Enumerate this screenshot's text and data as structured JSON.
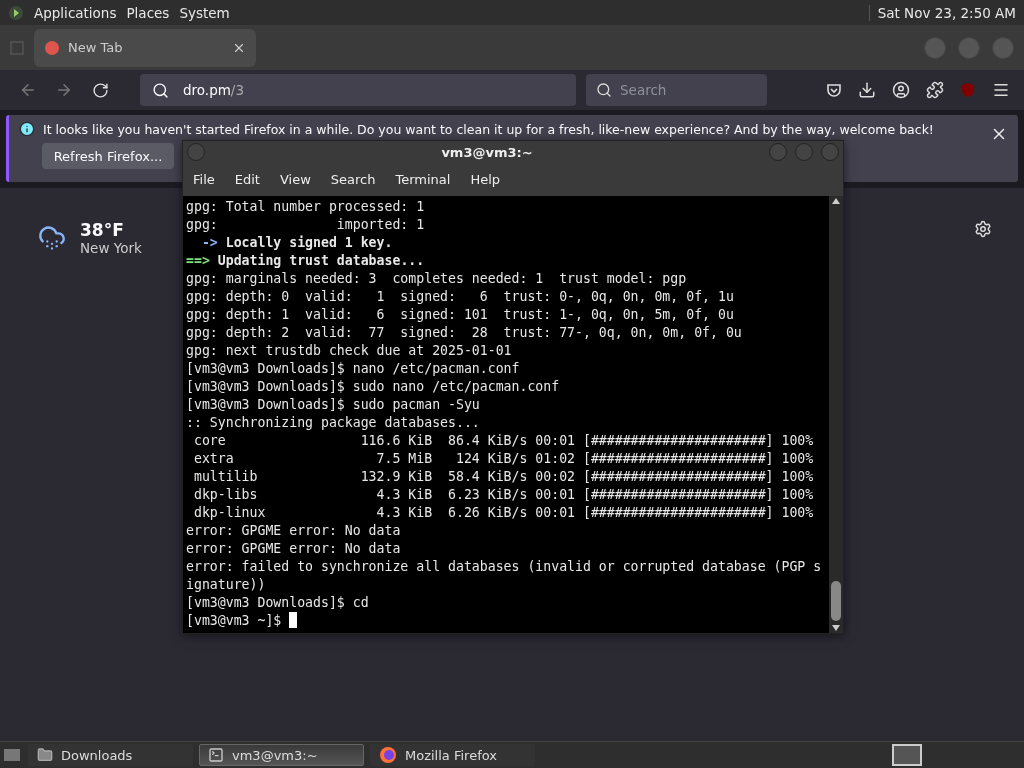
{
  "top_panel": {
    "menus": [
      "Applications",
      "Places",
      "System"
    ],
    "clock": "Sat Nov 23,  2:50 AM"
  },
  "browser": {
    "tabs": [
      {
        "label": "New Tab",
        "selected": true
      }
    ],
    "address": {
      "host": "dro.pm",
      "path": "/3"
    },
    "search": {
      "placeholder": "Search"
    },
    "notification": {
      "message": "It looks like you haven't started Firefox in a while. Do you want to clean it up for a fresh, like-new experience? And by the way, welcome back!",
      "button": "Refresh Firefox..."
    },
    "weather": {
      "temperature": "38°F",
      "location": "New York"
    }
  },
  "terminal": {
    "title": "vm3@vm3:~",
    "menus": [
      "File",
      "Edit",
      "View",
      "Search",
      "Terminal",
      "Help"
    ],
    "lines": [
      {
        "kind": "plain",
        "text": "gpg: Total number processed: 1"
      },
      {
        "kind": "plain",
        "text": "gpg:               imported: 1"
      },
      {
        "kind": "arrow",
        "prefix": "  ->",
        "text": " Locally signed 1 key."
      },
      {
        "kind": "header",
        "prefix": "==>",
        "text": " Updating trust database..."
      },
      {
        "kind": "plain",
        "text": "gpg: marginals needed: 3  completes needed: 1  trust model: pgp"
      },
      {
        "kind": "plain",
        "text": "gpg: depth: 0  valid:   1  signed:   6  trust: 0-, 0q, 0n, 0m, 0f, 1u"
      },
      {
        "kind": "plain",
        "text": "gpg: depth: 1  valid:   6  signed: 101  trust: 1-, 0q, 0n, 5m, 0f, 0u"
      },
      {
        "kind": "plain",
        "text": "gpg: depth: 2  valid:  77  signed:  28  trust: 77-, 0q, 0n, 0m, 0f, 0u"
      },
      {
        "kind": "plain",
        "text": "gpg: next trustdb check due at 2025-01-01"
      },
      {
        "kind": "plain",
        "text": "[vm3@vm3 Downloads]$ nano /etc/pacman.conf"
      },
      {
        "kind": "plain",
        "text": "[vm3@vm3 Downloads]$ sudo nano /etc/pacman.conf"
      },
      {
        "kind": "plain",
        "text": "[vm3@vm3 Downloads]$ sudo pacman -Syu"
      },
      {
        "kind": "plain",
        "text": ":: Synchronizing package databases..."
      },
      {
        "kind": "plain",
        "text": " core                 116.6 KiB  86.4 KiB/s 00:01 [######################] 100%"
      },
      {
        "kind": "plain",
        "text": " extra                  7.5 MiB   124 KiB/s 01:02 [######################] 100%"
      },
      {
        "kind": "plain",
        "text": " multilib             132.9 KiB  58.4 KiB/s 00:02 [######################] 100%"
      },
      {
        "kind": "plain",
        "text": " dkp-libs               4.3 KiB  6.23 KiB/s 00:01 [######################] 100%"
      },
      {
        "kind": "plain",
        "text": " dkp-linux              4.3 KiB  6.26 KiB/s 00:01 [######################] 100%"
      },
      {
        "kind": "plain",
        "text": "error: GPGME error: No data"
      },
      {
        "kind": "plain",
        "text": "error: GPGME error: No data"
      },
      {
        "kind": "plain",
        "text": "error: failed to synchronize all databases (invalid or corrupted database (PGP s"
      },
      {
        "kind": "plain",
        "text": "ignature))"
      },
      {
        "kind": "plain",
        "text": "[vm3@vm3 Downloads]$ cd"
      },
      {
        "kind": "prompt",
        "text": "[vm3@vm3 ~]$ "
      }
    ]
  },
  "taskbar": {
    "items": [
      {
        "kind": "folder",
        "label": "Downloads",
        "selected": false
      },
      {
        "kind": "terminal",
        "label": "vm3@vm3:~",
        "selected": true
      },
      {
        "kind": "browser",
        "label": "Mozilla Firefox",
        "selected": false
      }
    ]
  }
}
